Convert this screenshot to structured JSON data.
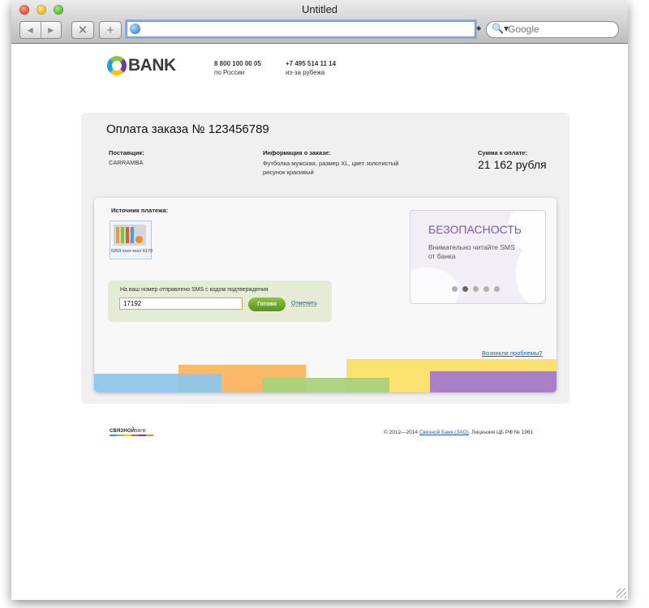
{
  "browser": {
    "window_title": "Untitled",
    "address_value": "",
    "search_placeholder": "Google",
    "back_glyph": "◀",
    "forward_glyph": "▶",
    "stop_glyph": "✕",
    "add_glyph": "+",
    "search_glyph": "🔍▾",
    "search_source_glyph": "◆"
  },
  "header": {
    "logo_text": "BANK",
    "phone1_number": "8 800 100 00 05",
    "phone1_note": "по России",
    "phone2_number": "+7 495 514 11 14",
    "phone2_note": "из-за рубежа"
  },
  "order": {
    "title": "Оплата заказа № 123456789",
    "supplier_label": "Поставщик:",
    "supplier_value": "CARRAMBA",
    "info_label": "Информация о заказе:",
    "info_line1": "Футболка мужская, размер XL, цвет золотистый",
    "info_line2": "рисунок красивый",
    "amount_label": "Сумма к оплате:",
    "amount_value": "21 162 рубля"
  },
  "payment": {
    "source_label": "Источник платежа:",
    "card_number": "5203 xxxx xxxx 6179",
    "sms_label": "На ваш номер отправлено SMS с кодом подтверждения",
    "sms_value": "17192",
    "done_button": "Готово",
    "cancel_link": "Отменить",
    "problem_link": "Возникли проблемы?"
  },
  "security": {
    "title": "БЕЗОПАСНОСТЬ",
    "text_line1": "Внимательно читайте SMS",
    "text_line2": "от банка",
    "active_slide": 2,
    "slide_count": 5
  },
  "footer": {
    "logo_text": "СВЯЗНОЙ",
    "logo_subtext": "БАНК",
    "copyright_prefix": "© 2012—2014",
    "copyright_link": "Связной Банк (ЗАО)",
    "copyright_suffix": ". Лицензия ЦБ РФ № 1961"
  },
  "colors": {
    "accent_purple": "#7d5aa8",
    "link_blue": "#1a5fb4",
    "button_green": "#8dc63f",
    "stripe_blue": "#8ec6ea",
    "stripe_orange": "#fbb86a",
    "stripe_green": "#a8d27a",
    "stripe_yellow": "#fbe26e",
    "stripe_purple": "#a97fc6"
  }
}
